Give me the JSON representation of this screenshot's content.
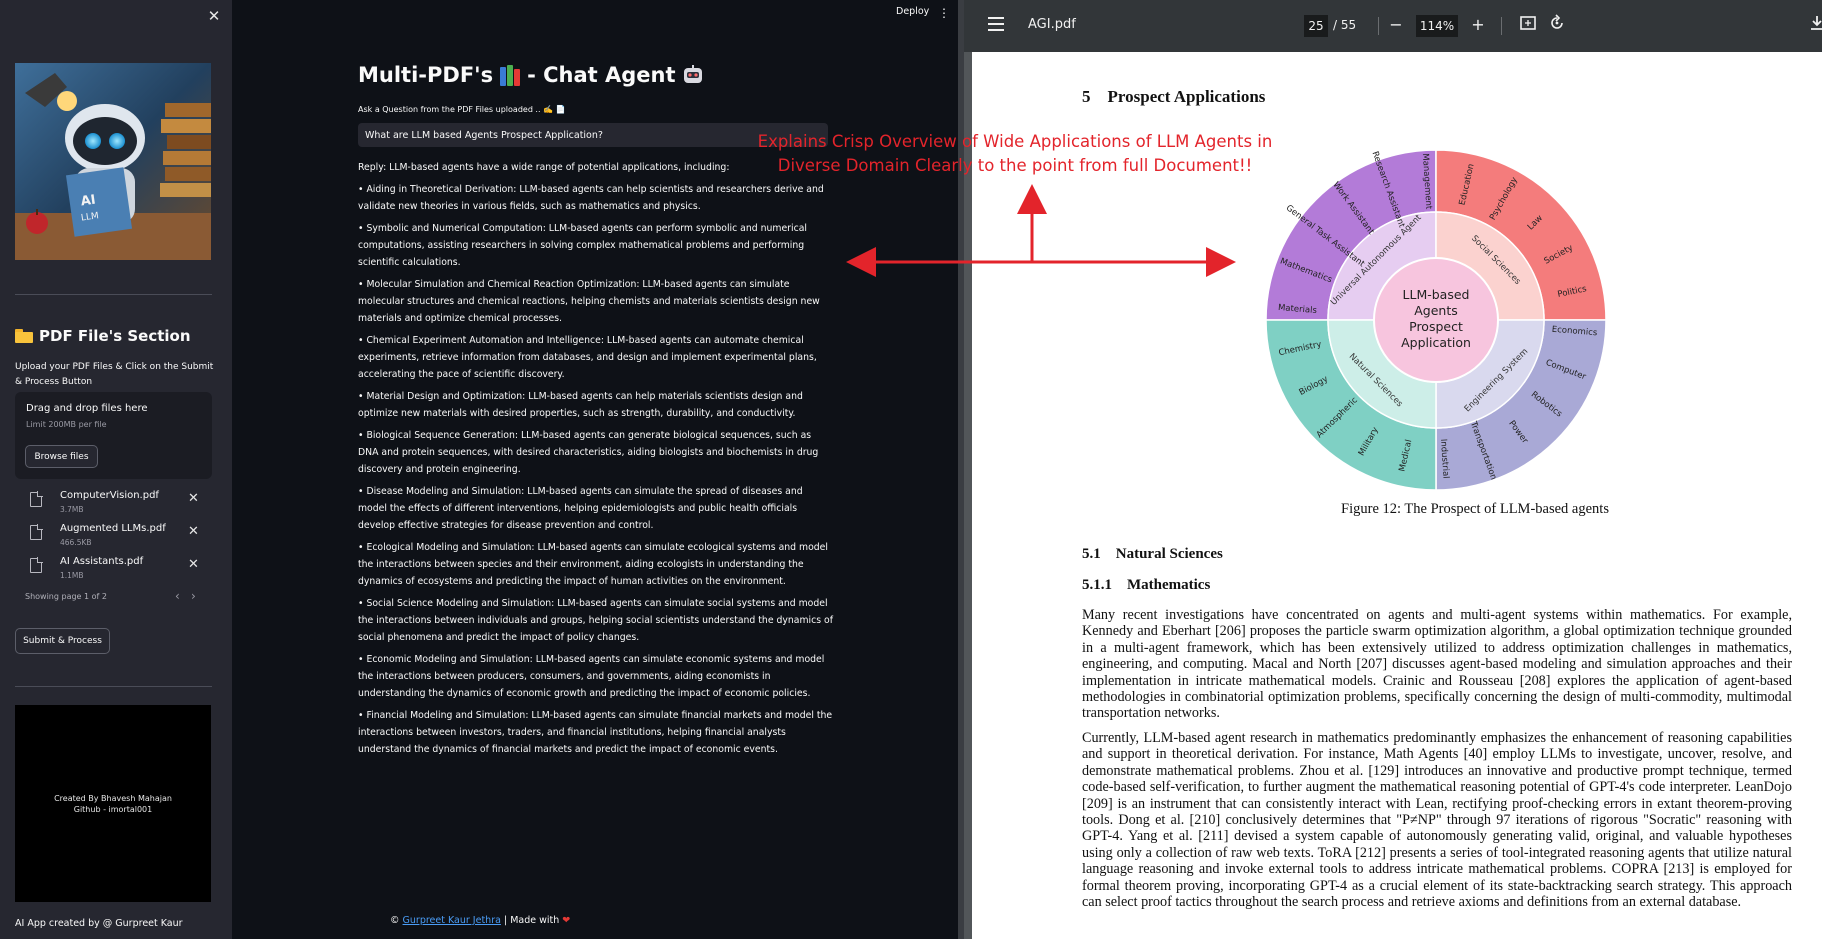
{
  "sidebar": {
    "section_heading": "PDF File's Section",
    "upload_instruction": "Upload your PDF Files & Click on the Submit & Process Button",
    "dropzone_title": "Drag and drop files here",
    "dropzone_limit": "Limit 200MB per file",
    "browse_label": "Browse files",
    "files": [
      {
        "name": "ComputerVision.pdf",
        "size": "3.7MB"
      },
      {
        "name": "Augmented LLMs.pdf",
        "size": "466.5KB"
      },
      {
        "name": "AI Assistants.pdf",
        "size": "1.1MB"
      }
    ],
    "pager_text": "Showing page 1 of 2",
    "submit_label": "Submit & Process",
    "credit_line1": "Created By Bhavesh Mahajan",
    "credit_line2": "Github - imortal001",
    "footer": "AI App created by @ Gurpreet Kaur"
  },
  "main": {
    "deploy_label": "Deploy",
    "title_part1": "Multi-PDF's",
    "title_part2": "- Chat Agent",
    "ask_label": "Ask a Question from the PDF Files uploaded .. ✍️ 📄",
    "question": "What are LLM based Agents Prospect Application?",
    "reply_intro": "Reply: LLM-based agents have a wide range of potential applications, including:",
    "reply_items": [
      "• Aiding in Theoretical Derivation: LLM-based agents can help scientists and researchers derive and validate new theories in various fields, such as mathematics and physics.",
      "• Symbolic and Numerical Computation: LLM-based agents can perform symbolic and numerical computations, assisting researchers in solving complex mathematical problems and performing scientific calculations.",
      "• Molecular Simulation and Chemical Reaction Optimization: LLM-based agents can simulate molecular structures and chemical reactions, helping chemists and materials scientists design new materials and optimize chemical processes.",
      "• Chemical Experiment Automation and Intelligence: LLM-based agents can automate chemical experiments, retrieve information from databases, and design and implement experimental plans, accelerating the pace of scientific discovery.",
      "• Material Design and Optimization: LLM-based agents can help materials scientists design and optimize new materials with desired properties, such as strength, durability, and conductivity.",
      "• Biological Sequence Generation: LLM-based agents can generate biological sequences, such as DNA and protein sequences, with desired characteristics, aiding biologists and biochemists in drug discovery and protein engineering.",
      "• Disease Modeling and Simulation: LLM-based agents can simulate the spread of diseases and model the effects of different interventions, helping epidemiologists and public health officials develop effective strategies for disease prevention and control.",
      "• Ecological Modeling and Simulation: LLM-based agents can simulate ecological systems and model the interactions between species and their environment, aiding ecologists in understanding the dynamics of ecosystems and predicting the impact of human activities on the environment.",
      "• Social Science Modeling and Simulation: LLM-based agents can simulate social systems and model the interactions between individuals and groups, helping social scientists understand the dynamics of social phenomena and predict the impact of policy changes.",
      "• Economic Modeling and Simulation: LLM-based agents can simulate economic systems and model the interactions between producers, consumers, and governments, aiding economists in understanding the dynamics of economic growth and predicting the impact of economic policies.",
      "• Financial Modeling and Simulation: LLM-based agents can simulate financial markets and model the interactions between investors, traders, and financial institutions, helping financial analysts understand the dynamics of financial markets and predict the impact of economic events."
    ],
    "footer_prefix": "©",
    "footer_link": "Gurpreet Kaur Jethra",
    "footer_suffix": "| Made with"
  },
  "annotation": {
    "line1": "Explains Crisp Overview of Wide Applications of LLM Agents in",
    "line2": "Diverse Domain Clearly to the point from full Document!!",
    "color": "#e3242b"
  },
  "viewer": {
    "file_title": "AGI.pdf",
    "current_page": "25",
    "total_pages": "/ 55",
    "zoom": "114%",
    "section_title": "5    Prospect Applications",
    "figure_caption": "Figure 12: The Prospect of LLM-based agents",
    "wheel": {
      "center": [
        "LLM-based",
        "Agents",
        "Prospect",
        "Application"
      ],
      "inner_labels": [
        "Universal Autonomous Agent",
        "Social Sciences",
        "Engineering System",
        "Natural Sciences"
      ],
      "outer_labels": [
        "Research Assistant",
        "Management",
        "Education",
        "Psychology",
        "Law",
        "Society",
        "Politics",
        "Economics",
        "Computer",
        "Robotics",
        "Power",
        "Transportation",
        "Industrial",
        "Medical",
        "Military",
        "Atmospheric",
        "Biology",
        "Chemistry",
        "Materials",
        "Mathematics",
        "General Task Assistant",
        "Work Assistant"
      ],
      "colors": {
        "purple": "#b37bd8",
        "red": "#f47c7c",
        "blue": "#a9a9d6",
        "teal": "#7fd0c4",
        "pink_center": "#f7c5de"
      }
    },
    "subsection1": "5.1    Natural Sciences",
    "subsection2": "5.1.1    Mathematics",
    "para1": "Many recent investigations have concentrated on agents and multi-agent systems within mathematics. For example, Kennedy and Eberhart [206] proposes the particle swarm optimization algorithm, a global optimization technique grounded in a multi-agent framework, which has been extensively utilized to address optimization challenges in mathematics, engineering, and computing. Macal and North [207] discusses agent-based modeling and simulation approaches and their implementation in intricate mathematical models. Crainic and Rousseau [208] explores the application of agent-based methodologies in combinatorial optimization problems, specifically concerning the design of multi-commodity, multimodal transportation networks.",
    "para2": "Currently, LLM-based agent research in mathematics predominantly emphasizes the enhancement of reasoning capabilities and support in theoretical derivation. For instance, Math Agents [40] employ LLMs to investigate, uncover, resolve, and demonstrate mathematical problems. Zhou et al. [129] introduces an innovative and productive prompt technique, termed code-based self-verification, to further augment the mathematical reasoning potential of GPT-4's code interpreter. LeanDojo [209] is an instrument that can consistently interact with Lean, rectifying proof-checking errors in extant theorem-proving tools. Dong et al. [210] conclusively determines that \"P≠NP\" through 97 iterations of rigorous \"Socratic\" reasoning with GPT-4. Yang et al. [211] devised a system capable of autonomously generating valid, original, and valuable hypotheses using only a collection of raw web texts. ToRA [212] presents a series of tool-integrated reasoning agents that utilize natural language reasoning and invoke external tools to address intricate mathematical problems. COPRA [213] is employed for formal theorem proving, incorporating GPT-4 as a crucial element of its state-backtracking search strategy. This approach can select proof tactics throughout the search process and retrieve axioms and definitions from an external database."
  }
}
